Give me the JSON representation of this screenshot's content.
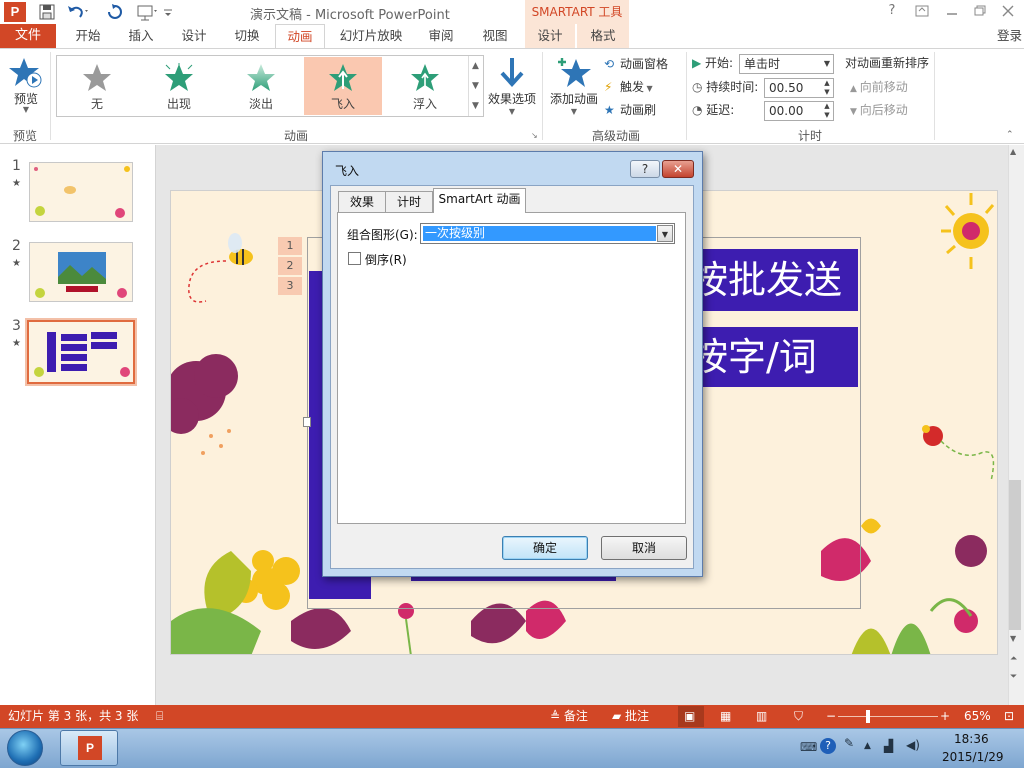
{
  "window": {
    "app_logo": "P",
    "title": "演示文稿 - Microsoft PowerPoint",
    "contextual_title": "SMARTART 工具",
    "help": "?"
  },
  "tabs": {
    "file": "文件",
    "items": [
      "开始",
      "插入",
      "设计",
      "切换",
      "动画",
      "幻灯片放映",
      "审阅",
      "视图",
      "设计",
      "格式"
    ],
    "login": "登录"
  },
  "ribbon": {
    "preview_label": "预览",
    "preview_group": "预览",
    "gallery": [
      "无",
      "出现",
      "淡出",
      "飞入",
      "浮入"
    ],
    "effect_options": "效果选项",
    "animation_group": "动画",
    "add_animation": "添加动画",
    "animation_pane": "动画窗格",
    "trigger": "触发",
    "animation_painter": "动画刷",
    "advanced_group": "高级动画",
    "start_label": "开始:",
    "start_value": "单击时",
    "duration_label": "持续时间:",
    "duration_value": "00.50",
    "delay_label": "延迟:",
    "delay_value": "00.00",
    "timing_group": "计时",
    "reorder_title": "对动画重新排序",
    "move_earlier": "向前移动",
    "move_later": "向后移动"
  },
  "thumbnails": [
    {
      "num": "1",
      "star": "★"
    },
    {
      "num": "2",
      "star": "★"
    },
    {
      "num": "3",
      "star": "★"
    }
  ],
  "slide": {
    "text1": "按批发送",
    "text2": "按字/词",
    "seq": [
      "1",
      "2",
      "3"
    ]
  },
  "dialog": {
    "title": "飞入",
    "help": "?",
    "close": "✕",
    "tabs": [
      "效果",
      "计时",
      "SmartArt 动画"
    ],
    "group_label": "组合图形(G):",
    "group_value": "一次按级别",
    "reverse_label": "倒序(R)",
    "reverse_checked": false,
    "ok": "确定",
    "cancel": "取消"
  },
  "status": {
    "slide_info": "幻灯片 第 3 张，共 3 张",
    "notes": "备注",
    "comments": "批注",
    "zoom": "65%"
  },
  "taskbar": {
    "time": "18:36",
    "date": "2015/1/29"
  },
  "colors": {
    "accent": "#d24726",
    "selected_gallery": "#fac8b0",
    "slide_bg": "#fdf1dc",
    "text_box": "#3d1db0"
  }
}
